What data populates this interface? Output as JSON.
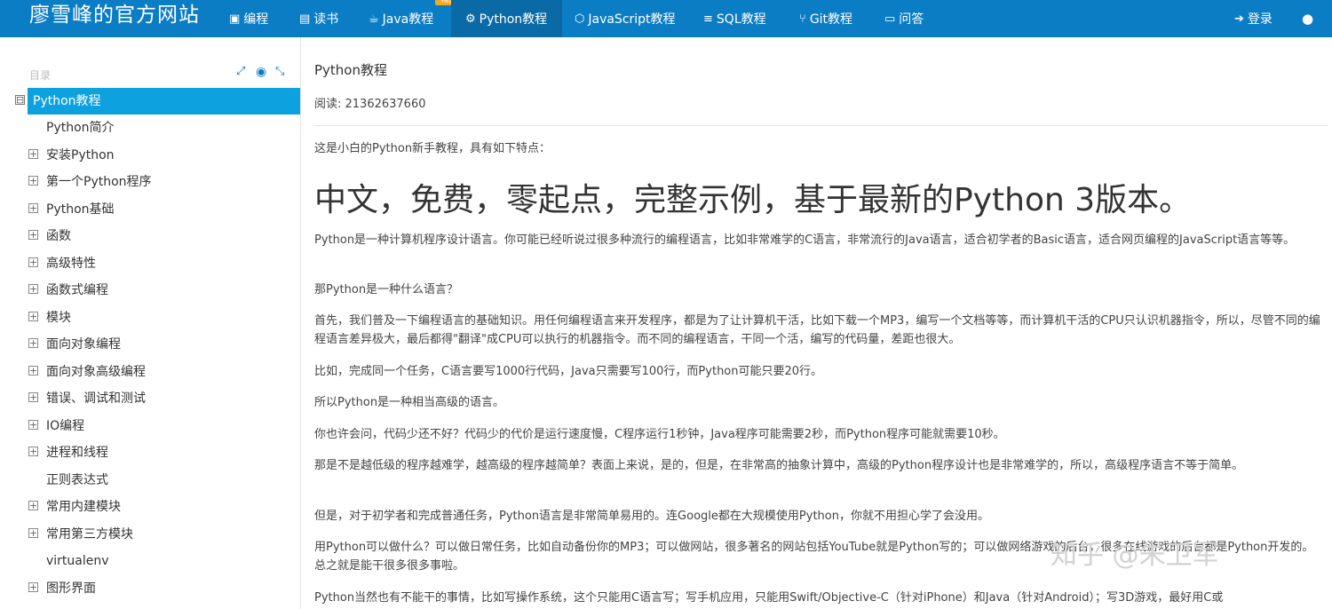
{
  "brand": "廖雪峰的官方网站",
  "nav": {
    "items": [
      {
        "label": "编程",
        "icon": "window-icon"
      },
      {
        "label": "读书",
        "icon": "book-icon"
      },
      {
        "label": "Java教程",
        "icon": "coffee-icon",
        "badge": "精品"
      },
      {
        "label": "Python教程",
        "icon": "python-icon",
        "active": true
      },
      {
        "label": "JavaScript教程",
        "icon": "javascript-icon"
      },
      {
        "label": "SQL教程",
        "icon": "database-icon"
      },
      {
        "label": "Git教程",
        "icon": "git-branch-icon"
      },
      {
        "label": "问答",
        "icon": "comment-icon"
      }
    ],
    "login": "登录",
    "globe_icon": "globe-icon"
  },
  "sidebar": {
    "label": "目录",
    "tools": [
      "expand-icon",
      "target-icon",
      "collapse-icon"
    ],
    "items": [
      {
        "label": "Python教程",
        "active": true,
        "toggle": "⊟"
      },
      {
        "label": "Python简介",
        "toggle": ""
      },
      {
        "label": "安装Python",
        "toggle": "+"
      },
      {
        "label": "第一个Python程序",
        "toggle": "+"
      },
      {
        "label": "Python基础",
        "toggle": "+"
      },
      {
        "label": "函数",
        "toggle": "+"
      },
      {
        "label": "高级特性",
        "toggle": "+"
      },
      {
        "label": "函数式编程",
        "toggle": "+"
      },
      {
        "label": "模块",
        "toggle": "+"
      },
      {
        "label": "面向对象编程",
        "toggle": "+"
      },
      {
        "label": "面向对象高级编程",
        "toggle": "+"
      },
      {
        "label": "错误、调试和测试",
        "toggle": "+"
      },
      {
        "label": "IO编程",
        "toggle": "+"
      },
      {
        "label": "进程和线程",
        "toggle": "+"
      },
      {
        "label": "正则表达式",
        "toggle": ""
      },
      {
        "label": "常用内建模块",
        "toggle": "+"
      },
      {
        "label": "常用第三方模块",
        "toggle": "+"
      },
      {
        "label": "virtualenv",
        "toggle": ""
      },
      {
        "label": "图形界面",
        "toggle": "+"
      }
    ]
  },
  "main": {
    "title": "Python教程",
    "read_label": "阅读: ",
    "read_count": "21362637660",
    "intro": "这是小白的Python新手教程，具有如下特点：",
    "headline": "中文，免费，零起点，完整示例，基于最新的Python 3版本。",
    "paragraphs": [
      "Python是一种计算机程序设计语言。你可能已经听说过很多种流行的编程语言，比如非常难学的C语言，非常流行的Java语言，适合初学者的Basic语言，适合网页编程的JavaScript语言等等。",
      "那Python是一种什么语言？",
      "首先，我们普及一下编程语言的基础知识。用任何编程语言来开发程序，都是为了让计算机干活，比如下载一个MP3，编写一个文档等等，而计算机干活的CPU只认识机器指令，所以，尽管不同的编程语言差异极大，最后都得\"翻译\"成CPU可以执行的机器指令。而不同的编程语言，干同一个活，编写的代码量，差距也很大。",
      "比如，完成同一个任务，C语言要写1000行代码，Java只需要写100行，而Python可能只要20行。",
      "所以Python是一种相当高级的语言。",
      "你也许会问，代码少还不好？代码少的代价是运行速度慢，C程序运行1秒钟，Java程序可能需要2秒，而Python程序可能就需要10秒。",
      "那是不是越低级的程序越难学，越高级的程序越简单？表面上来说，是的，但是，在非常高的抽象计算中，高级的Python程序设计也是非常难学的，所以，高级程序语言不等于简单。",
      "但是，对于初学者和完成普通任务，Python语言是非常简单易用的。连Google都在大规模使用Python，你就不用担心学了会没用。",
      "用Python可以做什么？可以做日常任务，比如自动备份你的MP3；可以做网站，很多著名的网站包括YouTube就是Python写的；可以做网络游戏的后台，很多在线游戏的后台都是Python开发的。总之就是能干很多很多事啦。",
      "Python当然也有不能干的事情，比如写操作系统，这个只能用C语言写；写手机应用，只能用Swift/Objective-C（针对iPhone）和Java（针对Android）；写3D游戏，最好用C或"
    ]
  },
  "watermark": "知乎 @朱卫军",
  "colors": {
    "nav_bg": "#0b7dc5",
    "active_item": "#0da1e0"
  }
}
